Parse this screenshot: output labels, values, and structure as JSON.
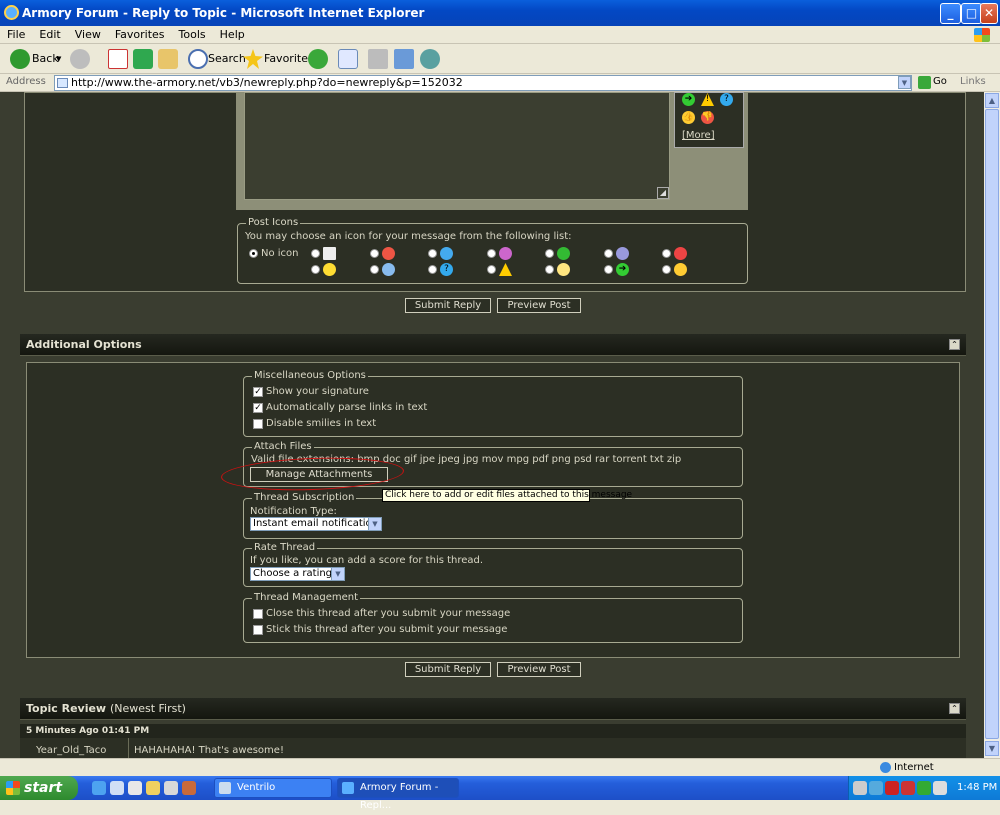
{
  "window": {
    "title": "Armory Forum - Reply to Topic - Microsoft Internet Explorer",
    "min": "_",
    "max": "□",
    "close": "✕"
  },
  "menu": [
    "File",
    "Edit",
    "View",
    "Favorites",
    "Tools",
    "Help"
  ],
  "toolbar": {
    "back": "Back",
    "search": "Search",
    "favorites": "Favorites"
  },
  "address": {
    "label": "Address",
    "url": "http://www.the-armory.net/vb3/newreply.php?do=newreply&p=152032",
    "go": "Go",
    "links": "Links"
  },
  "smilie_panel": {
    "more": "[More]"
  },
  "post_icons": {
    "legend": "Post Icons",
    "prompt": "You may choose an icon for your message from the following list:",
    "no_icon": "No icon"
  },
  "buttons": {
    "submit": "Submit Reply",
    "preview": "Preview Post"
  },
  "additional": {
    "title": "Additional Options"
  },
  "misc": {
    "legend": "Miscellaneous Options",
    "signature": "Show your signature",
    "parse_links": "Automatically parse links in text",
    "disable_smilies": "Disable smilies in text"
  },
  "attach": {
    "legend": "Attach Files",
    "extensions": "Valid file extensions: bmp doc gif jpe jpeg jpg mov mpg pdf png psd rar torrent txt zip",
    "manage": "Manage Attachments",
    "tooltip": "Click here to add or edit files attached to this message"
  },
  "subscription": {
    "legend": "Thread Subscription",
    "label": "Notification Type:",
    "value": "Instant email notification"
  },
  "rate": {
    "legend": "Rate Thread",
    "label": "If you like, you can add a score for this thread.",
    "value": "Choose a rating"
  },
  "management": {
    "legend": "Thread Management",
    "close": "Close this thread after you submit your message",
    "stick": "Stick this thread after you submit your message"
  },
  "review": {
    "title": "Topic Review",
    "sub": "(Newest First)",
    "time": "5 Minutes Ago 01:41 PM",
    "author": "Year_Old_Taco",
    "message": "HAHAHAHA! That's awesome!"
  },
  "status": {
    "zone": "Internet"
  },
  "taskbar": {
    "start": "start",
    "tasks": [
      "Ventrilo",
      "Armory Forum - Repl..."
    ],
    "clock": "1:48 PM"
  },
  "colors": {
    "page_bg": "#3a3d30",
    "panel_bg": "#2c2f24",
    "annotation": "#cc1111"
  }
}
